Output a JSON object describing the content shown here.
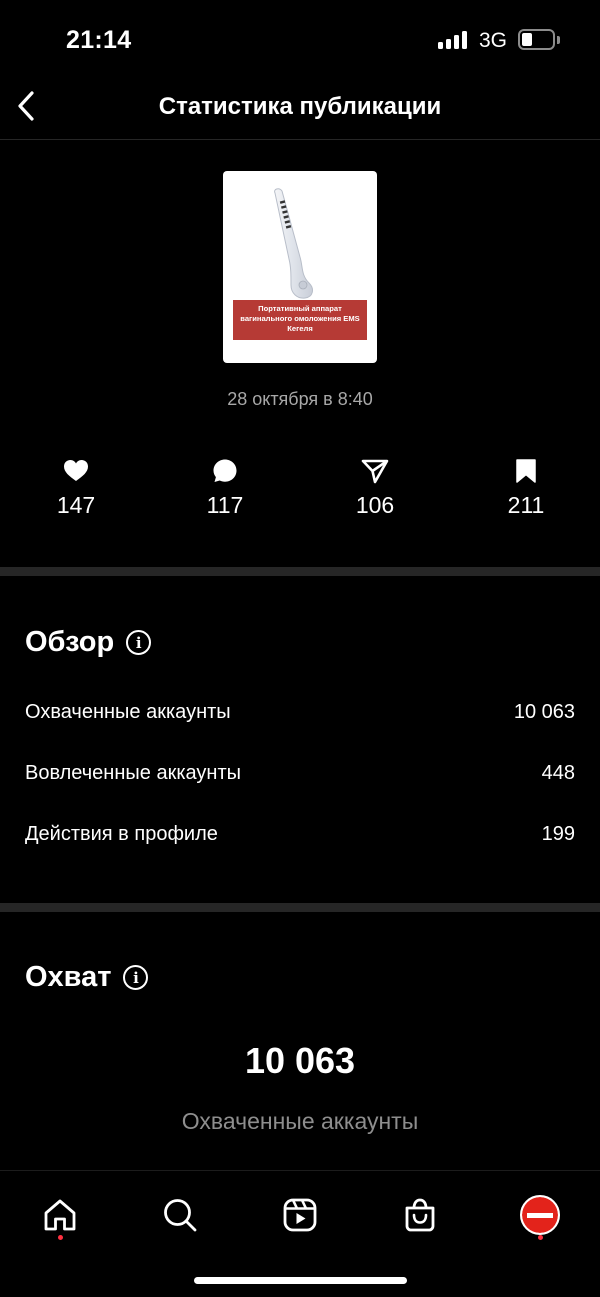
{
  "status_bar": {
    "time": "21:14",
    "network": "3G"
  },
  "nav": {
    "title": "Статистика публикации"
  },
  "post": {
    "banner_text": "Портативный аппарат вагинального омоложения EMS Кегеля",
    "date": "28 октября в 8:40"
  },
  "stats": {
    "likes": "147",
    "comments": "117",
    "shares": "106",
    "saves": "211"
  },
  "overview": {
    "title": "Обзор",
    "rows": [
      {
        "label": "Охваченные аккаунты",
        "value": "10 063"
      },
      {
        "label": "Вовлеченные аккаунты",
        "value": "448"
      },
      {
        "label": "Действия в профиле",
        "value": "199"
      }
    ]
  },
  "reach": {
    "title": "Охват",
    "value": "10 063",
    "label": "Охваченные аккаунты"
  },
  "icons": {
    "info": "i",
    "tabs": [
      "home-icon",
      "search-icon",
      "reels-icon",
      "shop-icon",
      "profile-avatar"
    ]
  },
  "colors": {
    "background": "#000000",
    "notification_dot": "#ff3040",
    "banner": "#b63a35"
  }
}
